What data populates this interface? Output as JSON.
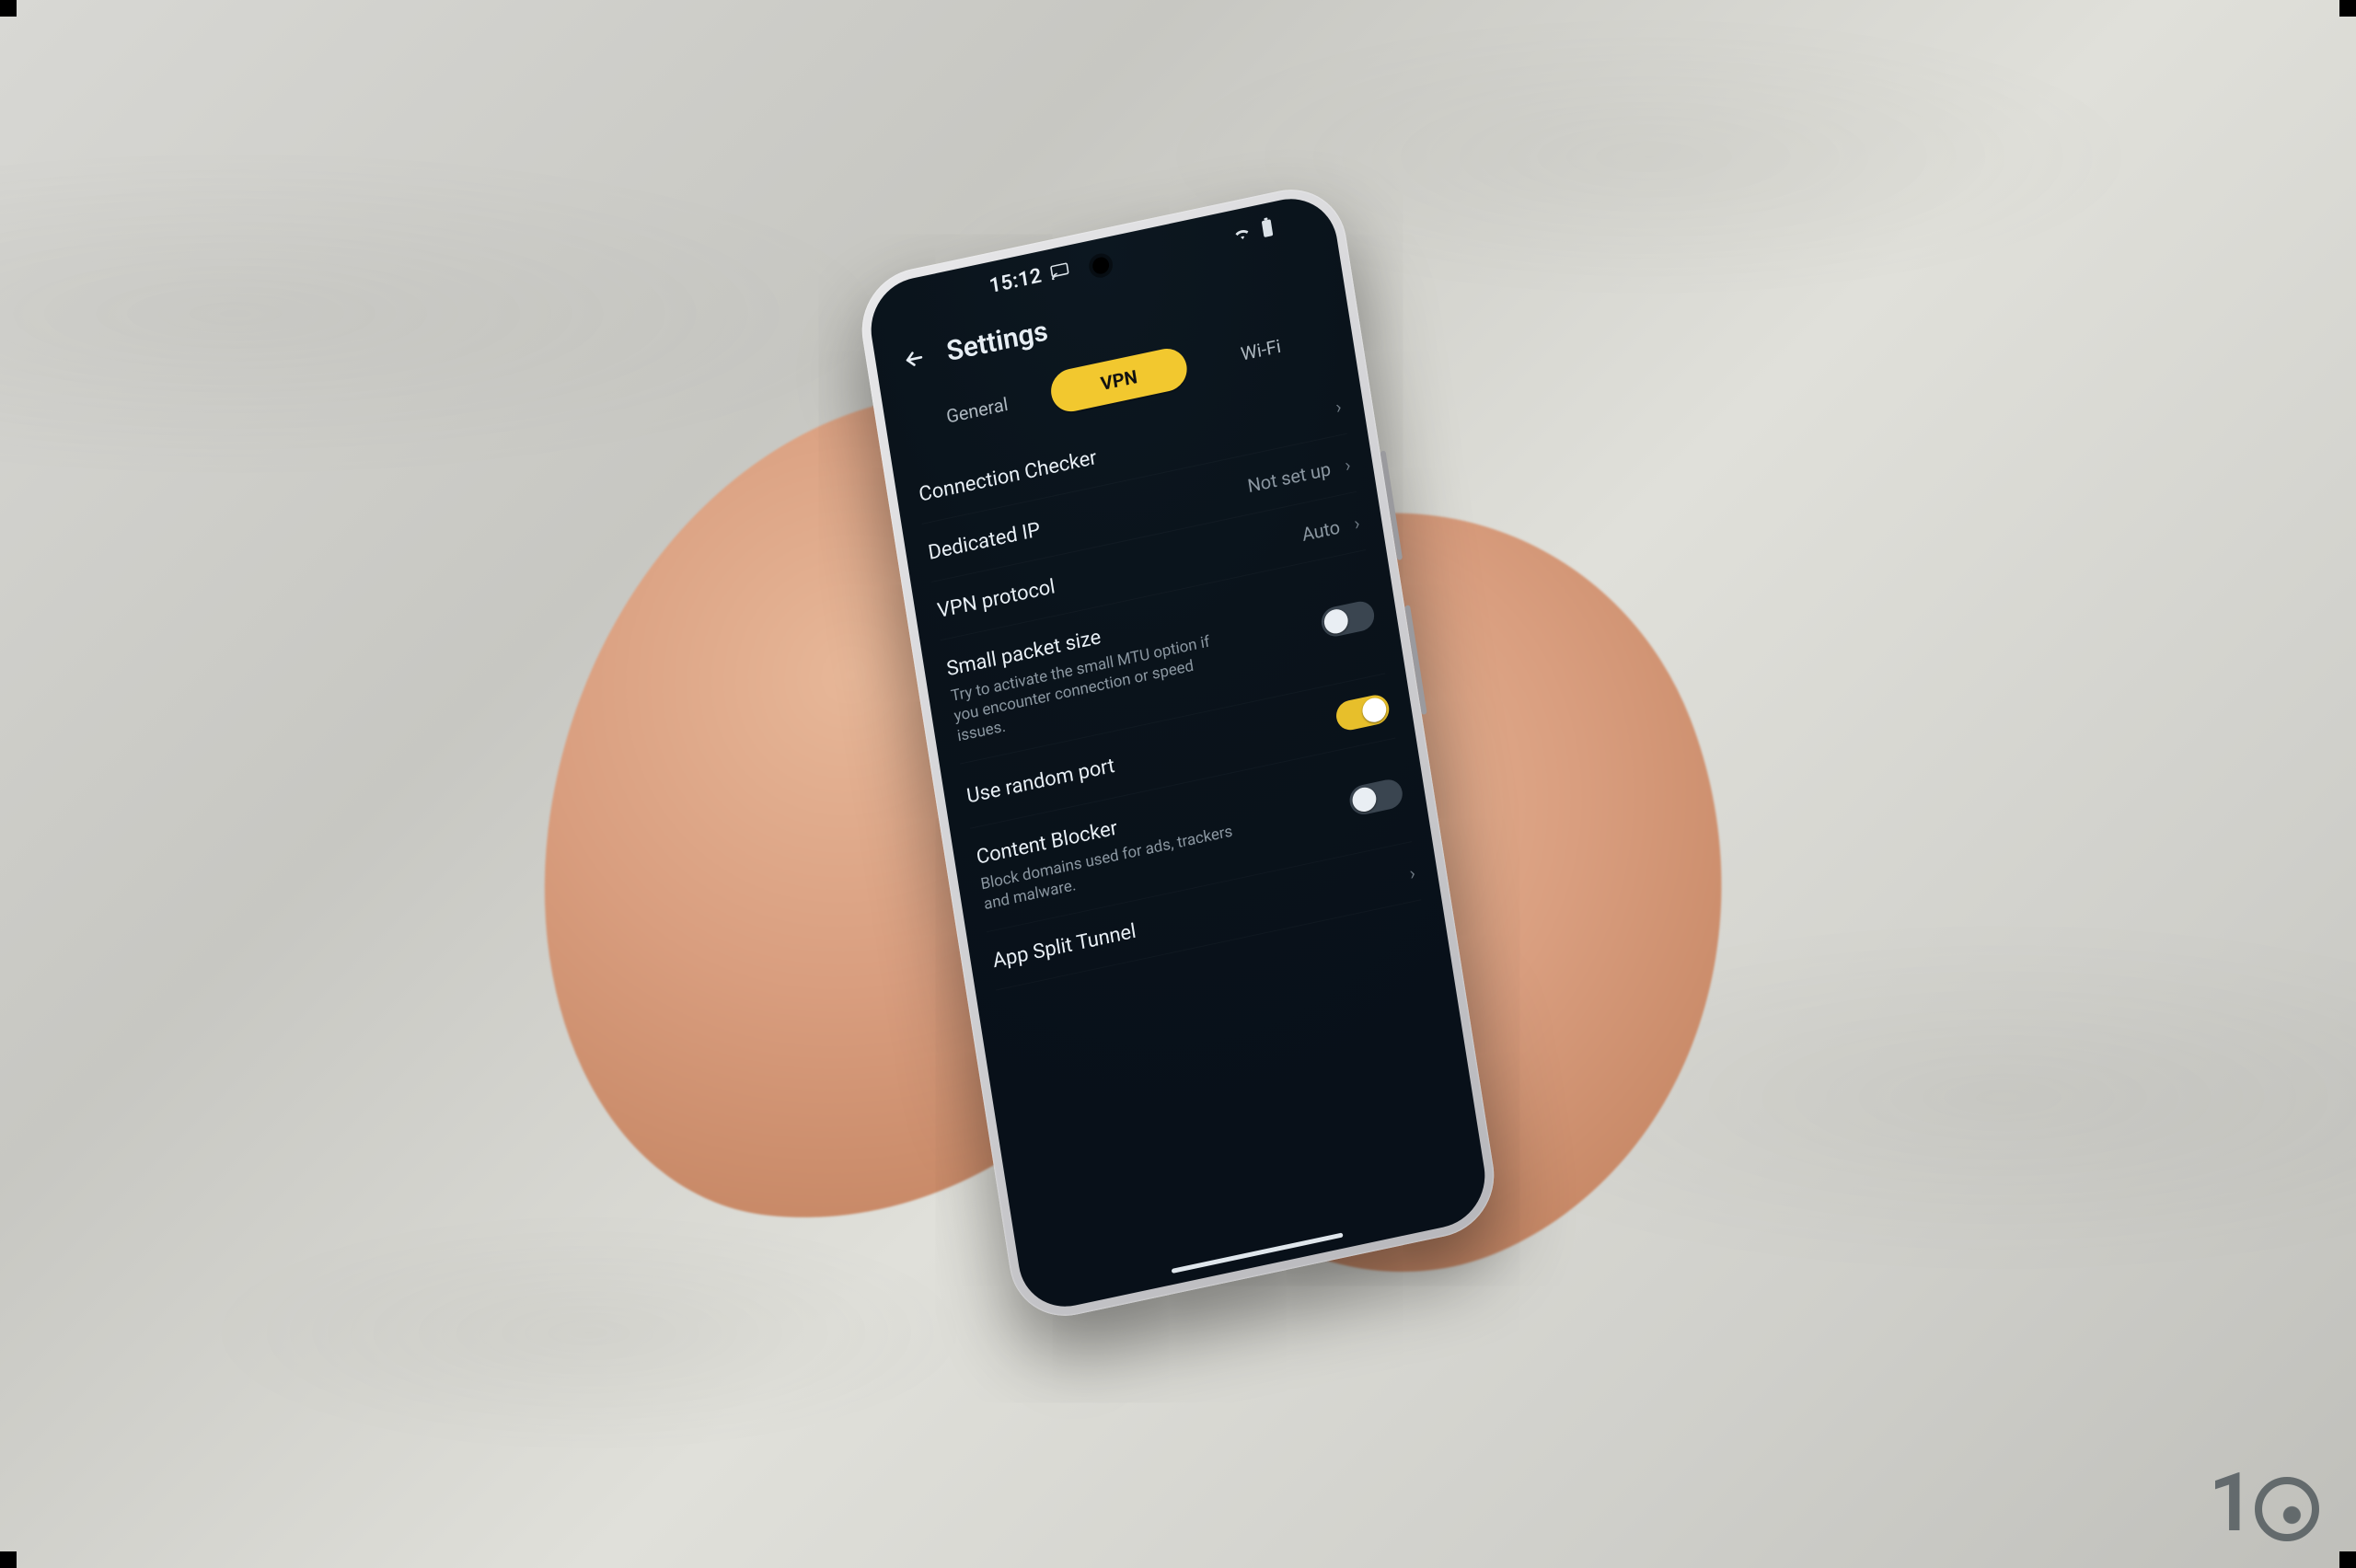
{
  "statusbar": {
    "time": "15:12",
    "cast_icon": "cast-icon",
    "wifi_icon": "wifi-icon",
    "battery_icon": "battery-icon"
  },
  "header": {
    "back_aria": "Back",
    "title": "Settings"
  },
  "tabs": {
    "items": [
      {
        "label": "General",
        "active": false
      },
      {
        "label": "VPN",
        "active": true
      },
      {
        "label": "Wi-Fi",
        "active": false
      }
    ]
  },
  "colors": {
    "accent": "#f2c82f",
    "bg": "#0a131b",
    "text": "#e8eff5",
    "muted": "#8b97a1"
  },
  "rows": [
    {
      "key": "connection_checker",
      "label": "Connection Checker",
      "type": "nav"
    },
    {
      "key": "dedicated_ip",
      "label": "Dedicated IP",
      "type": "nav",
      "value": "Not set up"
    },
    {
      "key": "vpn_protocol",
      "label": "VPN protocol",
      "type": "nav",
      "value": "Auto"
    },
    {
      "key": "small_packet_size",
      "label": "Small packet size",
      "desc": "Try to activate the small MTU option if you encounter connection or speed issues.",
      "type": "toggle",
      "on": false
    },
    {
      "key": "use_random_port",
      "label": "Use random port",
      "type": "toggle",
      "on": true
    },
    {
      "key": "content_blocker",
      "label": "Content Blocker",
      "desc": "Block domains used for ads, trackers and malware.",
      "type": "toggle",
      "on": false
    },
    {
      "key": "app_split_tunnel",
      "label": "App Split Tunnel",
      "type": "nav"
    }
  ],
  "watermark": {
    "digit": "1"
  }
}
